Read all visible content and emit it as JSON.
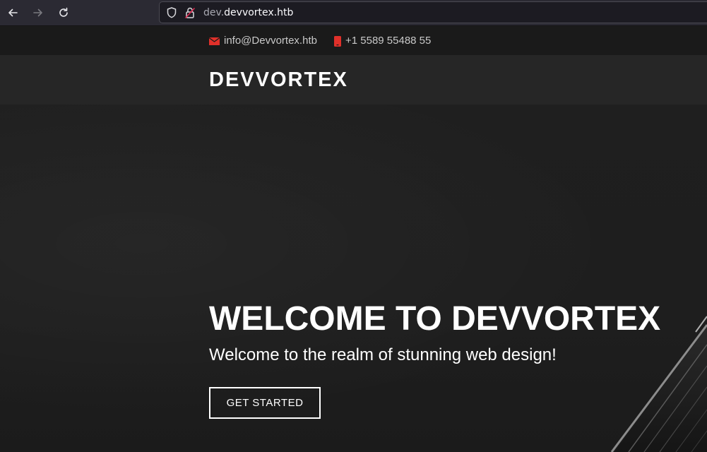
{
  "browser": {
    "url_subdomain": "dev.",
    "url_domain": "devvortex.htb",
    "icons": [
      "back-arrow-icon",
      "forward-arrow-icon",
      "reload-icon",
      "shield-icon",
      "lock-icon"
    ]
  },
  "topbar": {
    "email": "info@Devvortex.htb",
    "phone": "+1 5589 55488 55",
    "icon_color": "#e0302a"
  },
  "header": {
    "logo": "DEVVORTEX"
  },
  "hero": {
    "title": "WELCOME TO DEVVORTEX",
    "subtitle": "Welcome to the realm of stunning web design!",
    "cta_label": "GET STARTED"
  }
}
